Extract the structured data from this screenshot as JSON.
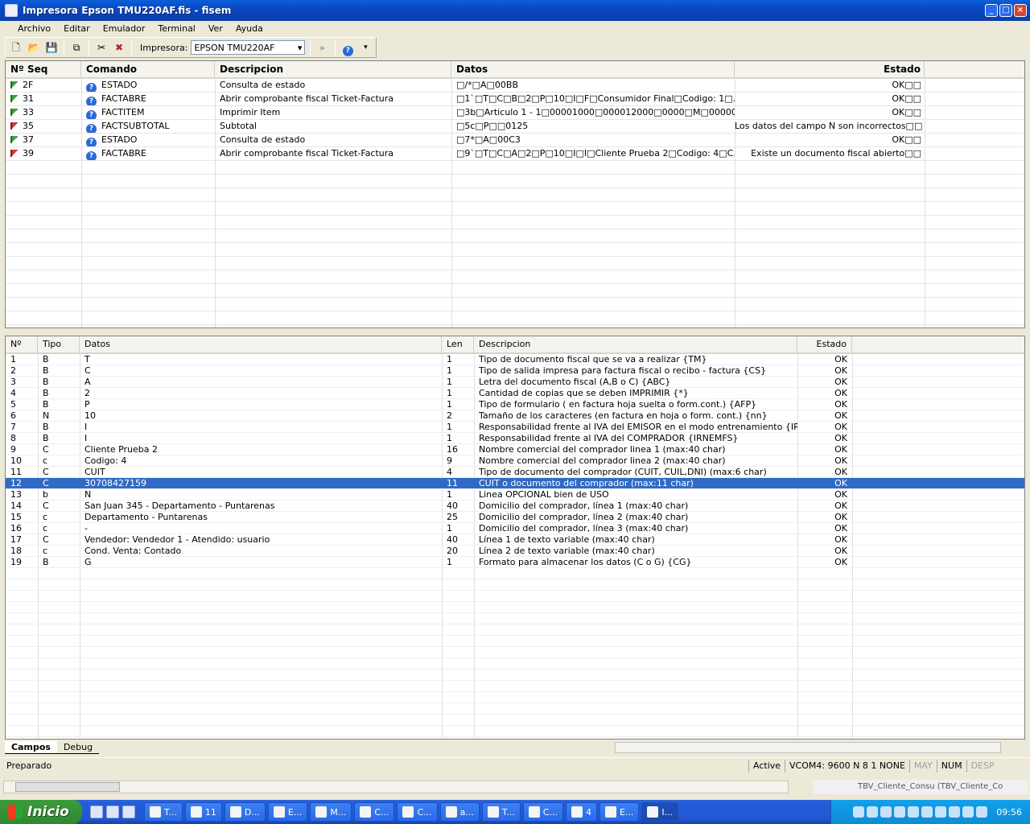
{
  "window": {
    "title": "Impresora Epson TMU220AF.fis - fisem"
  },
  "menu": [
    "Archivo",
    "Editar",
    "Emulador",
    "Terminal",
    "Ver",
    "Ayuda"
  ],
  "toolbar": {
    "printer_label": "Impresora:",
    "printer_value": "EPSON TMU220AF"
  },
  "commands": {
    "columns": [
      "Nº Seq",
      "Comando",
      "Descripcion",
      "Datos",
      "Estado"
    ],
    "rows": [
      {
        "seq": "2F",
        "flag": "green",
        "cmd": "ESTADO",
        "desc": "Consulta de estado",
        "datos": "□/*□A□00BB",
        "estado": "OK□□"
      },
      {
        "seq": "31",
        "flag": "green",
        "cmd": "FACTABRE",
        "desc": "Abrir comprobante fiscal Ticket-Factura",
        "datos": "□1`□T□C□B□2□P□10□I□F□Consumidor Final□Codigo: 1□...",
        "estado": "OK□□"
      },
      {
        "seq": "33",
        "flag": "green",
        "cmd": "FACTITEM",
        "desc": "Imprimir Item",
        "datos": "□3b□Articulo 1 - 1□00001000□000012000□0000□M□00000□...",
        "estado": "OK□□"
      },
      {
        "seq": "35",
        "flag": "red",
        "cmd": "FACTSUBTOTAL",
        "desc": "Subtotal",
        "datos": "□5c□P□□0125",
        "estado": "Los datos del campo N son incorrectos□□"
      },
      {
        "seq": "37",
        "flag": "green",
        "cmd": "ESTADO",
        "desc": "Consulta de estado",
        "datos": "□7*□A□00C3",
        "estado": "OK□□"
      },
      {
        "seq": "39",
        "flag": "red",
        "cmd": "FACTABRE",
        "desc": "Abrir comprobante fiscal Ticket-Factura",
        "datos": "□9`□T□C□A□2□P□10□I□I□Cliente Prueba 2□Codigo: 4□C...",
        "estado": "Existe un documento fiscal abierto□□"
      }
    ]
  },
  "fields": {
    "columns": [
      "Nº",
      "Tipo",
      "Datos",
      "Len",
      "Descripcion",
      "Estado"
    ],
    "selected_index": 11,
    "rows": [
      {
        "n": "1",
        "tipo": "B",
        "datos": "T",
        "len": "1",
        "desc": "Tipo de documento fiscal que se va a realizar {TM}",
        "estado": "OK"
      },
      {
        "n": "2",
        "tipo": "B",
        "datos": "C",
        "len": "1",
        "desc": "Tipo de salida impresa para factura fiscal o recibo - factura {CS}",
        "estado": "OK"
      },
      {
        "n": "3",
        "tipo": "B",
        "datos": "A",
        "len": "1",
        "desc": "Letra del documento fiscal (A,B o C) {ABC}",
        "estado": "OK"
      },
      {
        "n": "4",
        "tipo": "B",
        "datos": "2",
        "len": "1",
        "desc": "Cantidad de copias que se deben IMPRIMIR {*}",
        "estado": "OK"
      },
      {
        "n": "5",
        "tipo": "B",
        "datos": "P",
        "len": "1",
        "desc": "Tipo de formulario ( en factura hoja suelta o form.cont.) {AFP}",
        "estado": "OK"
      },
      {
        "n": "6",
        "tipo": "N",
        "datos": "10",
        "len": "2",
        "desc": "Tamaño de los caracteres (en factura en hoja o form. cont.) {nn}",
        "estado": "OK"
      },
      {
        "n": "7",
        "tipo": "B",
        "datos": "I",
        "len": "1",
        "desc": "Responsabilidad frente al IVA del EMISOR en el modo entrenamiento {IRNEM}",
        "estado": "OK"
      },
      {
        "n": "8",
        "tipo": "B",
        "datos": "I",
        "len": "1",
        "desc": "Responsabilidad frente al IVA del COMPRADOR {IRNEMFS}",
        "estado": "OK"
      },
      {
        "n": "9",
        "tipo": "C",
        "datos": "Cliente Prueba 2",
        "len": "16",
        "desc": "Nombre comercial del comprador linea 1 (max:40 char)",
        "estado": "OK"
      },
      {
        "n": "10",
        "tipo": "c",
        "datos": "Codigo: 4",
        "len": "9",
        "desc": "Nombre comercial del comprador linea 2 (max:40 char)",
        "estado": "OK"
      },
      {
        "n": "11",
        "tipo": "C",
        "datos": "CUIT",
        "len": "4",
        "desc": "Tipo de documento del comprador (CUIT, CUIL,DNI) (max:6 char)",
        "estado": "OK"
      },
      {
        "n": "12",
        "tipo": "C",
        "datos": "30708427159",
        "len": "11",
        "desc": "CUIT o documento del comprador (max:11 char)",
        "estado": "OK"
      },
      {
        "n": "13",
        "tipo": "b",
        "datos": "N",
        "len": "1",
        "desc": "Linea OPCIONAL bien de USO",
        "estado": "OK"
      },
      {
        "n": "14",
        "tipo": "C",
        "datos": "San Juan 345 - Departamento - Puntarenas",
        "len": "40",
        "desc": "Domicilio del comprador, línea 1 (max:40 char)",
        "estado": "OK"
      },
      {
        "n": "15",
        "tipo": "c",
        "datos": "Departamento - Puntarenas",
        "len": "25",
        "desc": "Domicilio del comprador, línea 2 (max:40 char)",
        "estado": "OK"
      },
      {
        "n": "16",
        "tipo": "c",
        "datos": "-",
        "len": "1",
        "desc": "Domicilio del comprador, línea 3 (max:40 char)",
        "estado": "OK"
      },
      {
        "n": "17",
        "tipo": "C",
        "datos": "Vendedor: Vendedor 1 - Atendido: usuario",
        "len": "40",
        "desc": "Línea 1 de texto variable (max:40 char)",
        "estado": "OK"
      },
      {
        "n": "18",
        "tipo": "c",
        "datos": "Cond. Venta: Contado",
        "len": "20",
        "desc": "Línea 2 de texto variable (max:40 char)",
        "estado": "OK"
      },
      {
        "n": "19",
        "tipo": "B",
        "datos": "G",
        "len": "1",
        "desc": "Formato para almacenar los datos (C o G) {CG}",
        "estado": "OK"
      }
    ]
  },
  "tabs": [
    "Campos",
    "Debug"
  ],
  "status": {
    "message": "Preparado",
    "active": "Active",
    "port": "VCOM4:",
    "baud": "9600",
    "parity": "N",
    "bits": "8",
    "stop": "1",
    "flow": "NONE",
    "may": "MAY",
    "num": "NUM",
    "desp": "DESP"
  },
  "background_text": "TBV_Cliente_Consu (TBV_Cliente_Co",
  "taskbar": {
    "start_label": "Inicio",
    "buttons": [
      "T...",
      "11",
      "D...",
      "E...",
      "M...",
      "C...",
      "C...",
      "a...",
      "T...",
      "C...",
      "4",
      "E...",
      "I..."
    ],
    "active_index": 12,
    "clock": "09:56"
  }
}
